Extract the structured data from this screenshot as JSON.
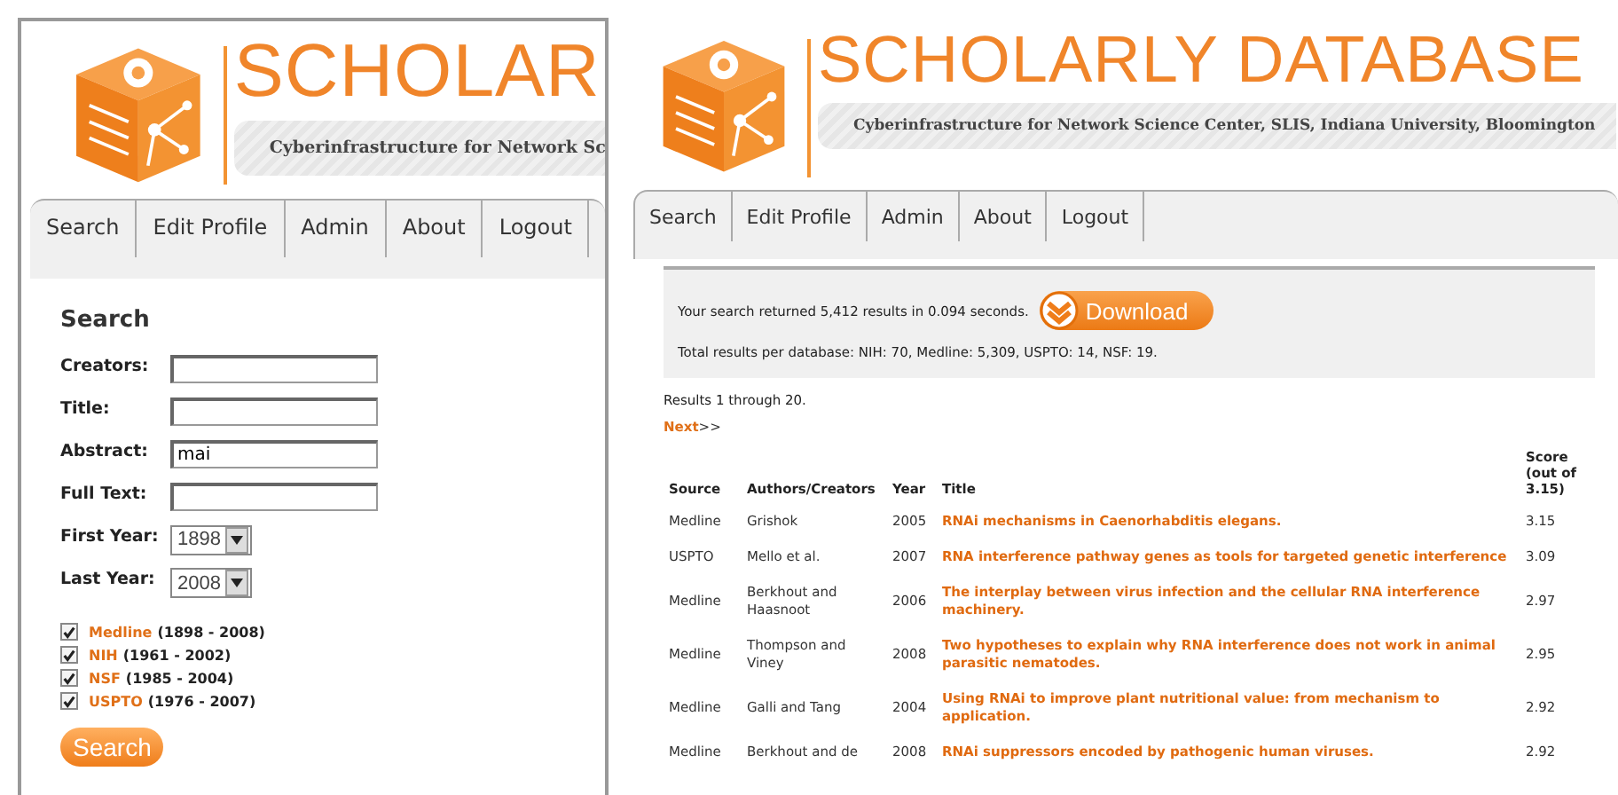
{
  "left": {
    "header": {
      "title": "SCHOLAR",
      "subtitle": "Cyberinfrastructure for Network Sc"
    },
    "tabs": [
      {
        "label": "Search"
      },
      {
        "label": "Edit Profile"
      },
      {
        "label": "Admin"
      },
      {
        "label": "About"
      },
      {
        "label": "Logout"
      }
    ],
    "form": {
      "heading": "Search",
      "fields": [
        {
          "kind": "text",
          "label": "Creators:"
        },
        {
          "kind": "text",
          "label": "Title:"
        },
        {
          "kind": "text",
          "label": "Abstract:",
          "value": "mai"
        },
        {
          "kind": "text",
          "label": "Full Text:"
        },
        {
          "kind": "select",
          "label": "First Year:",
          "value": "1898"
        },
        {
          "kind": "select",
          "label": "Last Year:",
          "value": "2008"
        }
      ],
      "databases": [
        {
          "name": "Medline",
          "range": "(1898 - 2008)",
          "checked": true
        },
        {
          "name": "NIH",
          "range": "(1961 - 2002)",
          "checked": true
        },
        {
          "name": "NSF",
          "range": "(1985 - 2004)",
          "checked": true
        },
        {
          "name": "USPTO",
          "range": "(1976 - 2007)",
          "checked": true
        }
      ],
      "button": "Search"
    }
  },
  "right": {
    "header": {
      "title": "SCHOLARLY DATABASE",
      "subtitle": "Cyberinfrastructure for Network Science Center, SLIS, Indiana University, Bloomington"
    },
    "tabs": [
      {
        "label": "Search"
      },
      {
        "label": "Edit Profile"
      },
      {
        "label": "Admin"
      },
      {
        "label": "About"
      },
      {
        "label": "Logout"
      }
    ],
    "summary": {
      "text": "Your search returned 5,412 results in 0.094 seconds.",
      "download": "Download",
      "totals": "Total results per database: NIH: 70, Medline: 5,309, USPTO: 14, NSF: 19."
    },
    "range": "Results 1 through 20.",
    "next": "Next",
    "next_arrows": ">>",
    "table": {
      "columns": [
        "Source",
        "Authors/Creators",
        "Year",
        "Title",
        "Score (out of 3.15)"
      ],
      "rows": [
        [
          "Medline",
          "Grishok",
          "2005",
          "RNAi mechanisms in Caenorhabditis elegans.",
          "3.15"
        ],
        [
          "USPTO",
          "Mello et al.",
          "2007",
          "RNA interference pathway genes as tools for targeted genetic interference",
          "3.09"
        ],
        [
          "Medline",
          "Berkhout and Haasnoot",
          "2006",
          "The interplay between virus infection and the cellular RNA interference machinery.",
          "2.97"
        ],
        [
          "Medline",
          "Thompson and Viney",
          "2008",
          "Two hypotheses to explain why RNA interference does not work in animal parasitic nematodes.",
          "2.95"
        ],
        [
          "Medline",
          "Galli and Tang",
          "2004",
          "Using RNAi to improve plant nutritional value: from mechanism to application.",
          "2.92"
        ],
        [
          "Medline",
          "Berkhout and de",
          "2008",
          "RNAi suppressors encoded by pathogenic human viruses.",
          "2.92"
        ]
      ]
    }
  }
}
